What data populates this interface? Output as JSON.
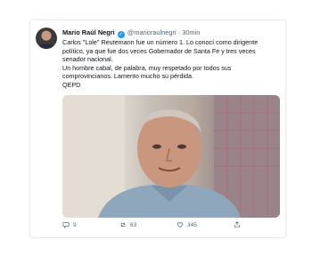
{
  "tweet": {
    "author_name": "Mario Raúl Negri",
    "verified_icon": "verified-badge-icon",
    "handle": "@marioraulnegri",
    "separator": "·",
    "time": "30min",
    "lines": [
      "Carlos \"Lole\" Reutemann fue un número 1. Lo conocí como dirigente político, ya que fue dos veces Gobernador de Santa Fe y tres veces senador nacional.",
      "Un hombre cabal, de palabra, muy respetado por todos sus comprovincianos. Lamento mucho su pérdida.",
      "QEPD"
    ],
    "actions": {
      "replies": "9",
      "retweets": "63",
      "likes": "345"
    }
  },
  "colors": {
    "accent": "#1d9bf0",
    "muted_text": "#536471",
    "border": "#e6ecf0"
  }
}
